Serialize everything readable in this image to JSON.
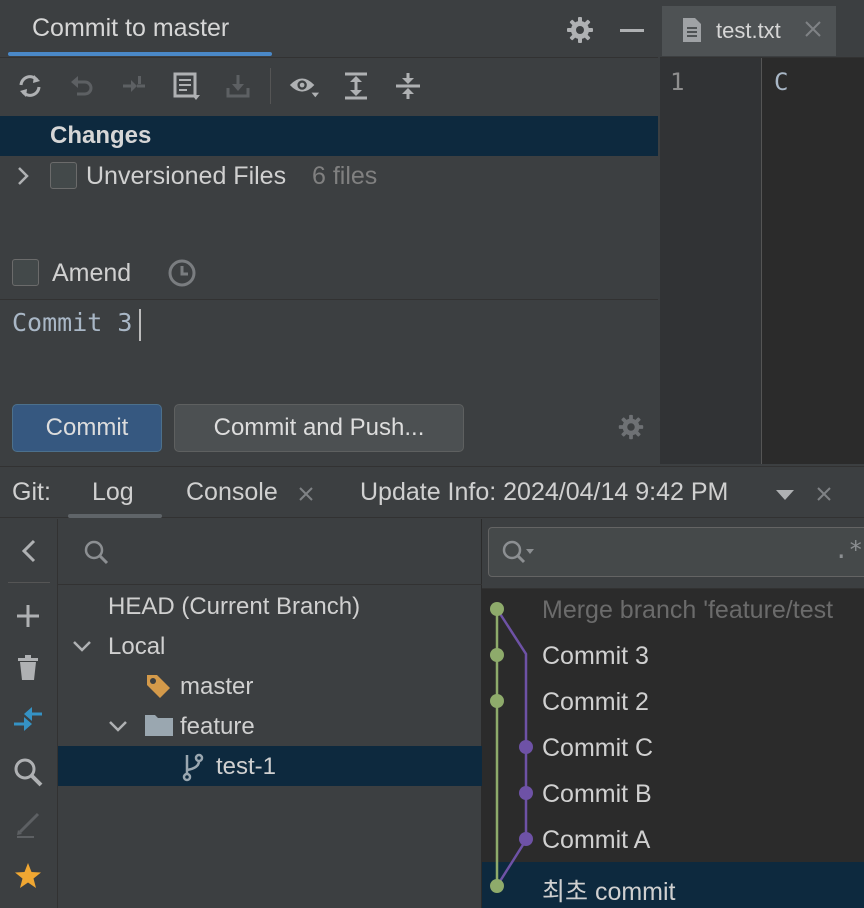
{
  "commit_panel": {
    "title": "Commit to master",
    "changes_label": "Changes",
    "unversioned_label": "Unversioned Files",
    "unversioned_count": "6 files",
    "amend_label": "Amend",
    "message": "Commit 3",
    "commit_button": "Commit",
    "commit_push_button": "Commit and Push...",
    "toolbar_icons": [
      "refresh-icon",
      "rollback-icon",
      "diff-icon",
      "changelist-icon",
      "shelve-icon",
      "eye-icon",
      "expand-all-icon",
      "collapse-all-icon"
    ]
  },
  "editor": {
    "tab_label": "test.txt",
    "line_number": "1",
    "line_text": "C"
  },
  "git": {
    "prefix": "Git:",
    "tabs": [
      {
        "label": "Log",
        "active": true
      },
      {
        "label": "Console",
        "closable": true
      },
      {
        "label": "Update Info: 2024/04/14 9:42 PM",
        "closable": true
      }
    ]
  },
  "branches": {
    "head": "HEAD (Current Branch)",
    "local": "Local",
    "master": "master",
    "feature": "feature",
    "test1": "test-1"
  },
  "commits": [
    {
      "message": "Merge branch 'feature/test",
      "dim": true
    },
    {
      "message": "Commit 3"
    },
    {
      "message": "Commit 2"
    },
    {
      "message": "Commit C"
    },
    {
      "message": "Commit B"
    },
    {
      "message": "Commit A"
    },
    {
      "message": "최초 commit",
      "selected": true
    }
  ],
  "colors": {
    "accent": "#4a88c7",
    "selection": "#0d293e",
    "graph_green": "#8eab6b",
    "graph_purple": "#6e52a6",
    "tag_orange": "#d49a4a",
    "star": "#f0a732"
  }
}
